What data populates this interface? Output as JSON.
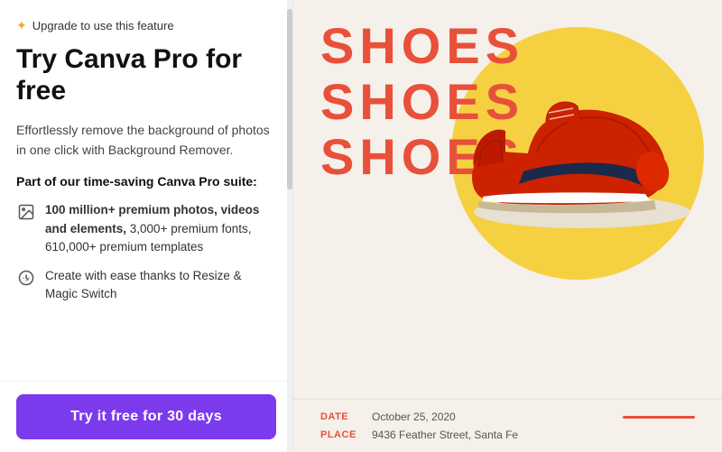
{
  "left_panel": {
    "badge": {
      "star": "✦",
      "text": "Upgrade to use this feature"
    },
    "heading": "Try Canva Pro for free",
    "description": "Effortlessly remove the background of photos in one click with Background Remover.",
    "suite_heading": "Part of our time-saving Canva Pro suite:",
    "features": [
      {
        "icon": "image-icon",
        "text_bold": "100 million+ premium photos, videos and elements,",
        "text_normal": " 3,000+ premium fonts, 610,000+ premium templates"
      },
      {
        "icon": "resize-icon",
        "text_bold": "",
        "text_normal": "Create with ease thanks to Resize & Magic Switch"
      }
    ],
    "cta_button": "Try it free for 30 days"
  },
  "right_panel": {
    "shoes_lines": [
      "SHOES",
      "SHOES",
      "SHOES"
    ],
    "info": {
      "date_label": "DATE",
      "date_value": "October 25, 2020",
      "place_label": "PLACE",
      "place_value": "9436 Feather Street, Santa Fe"
    }
  }
}
